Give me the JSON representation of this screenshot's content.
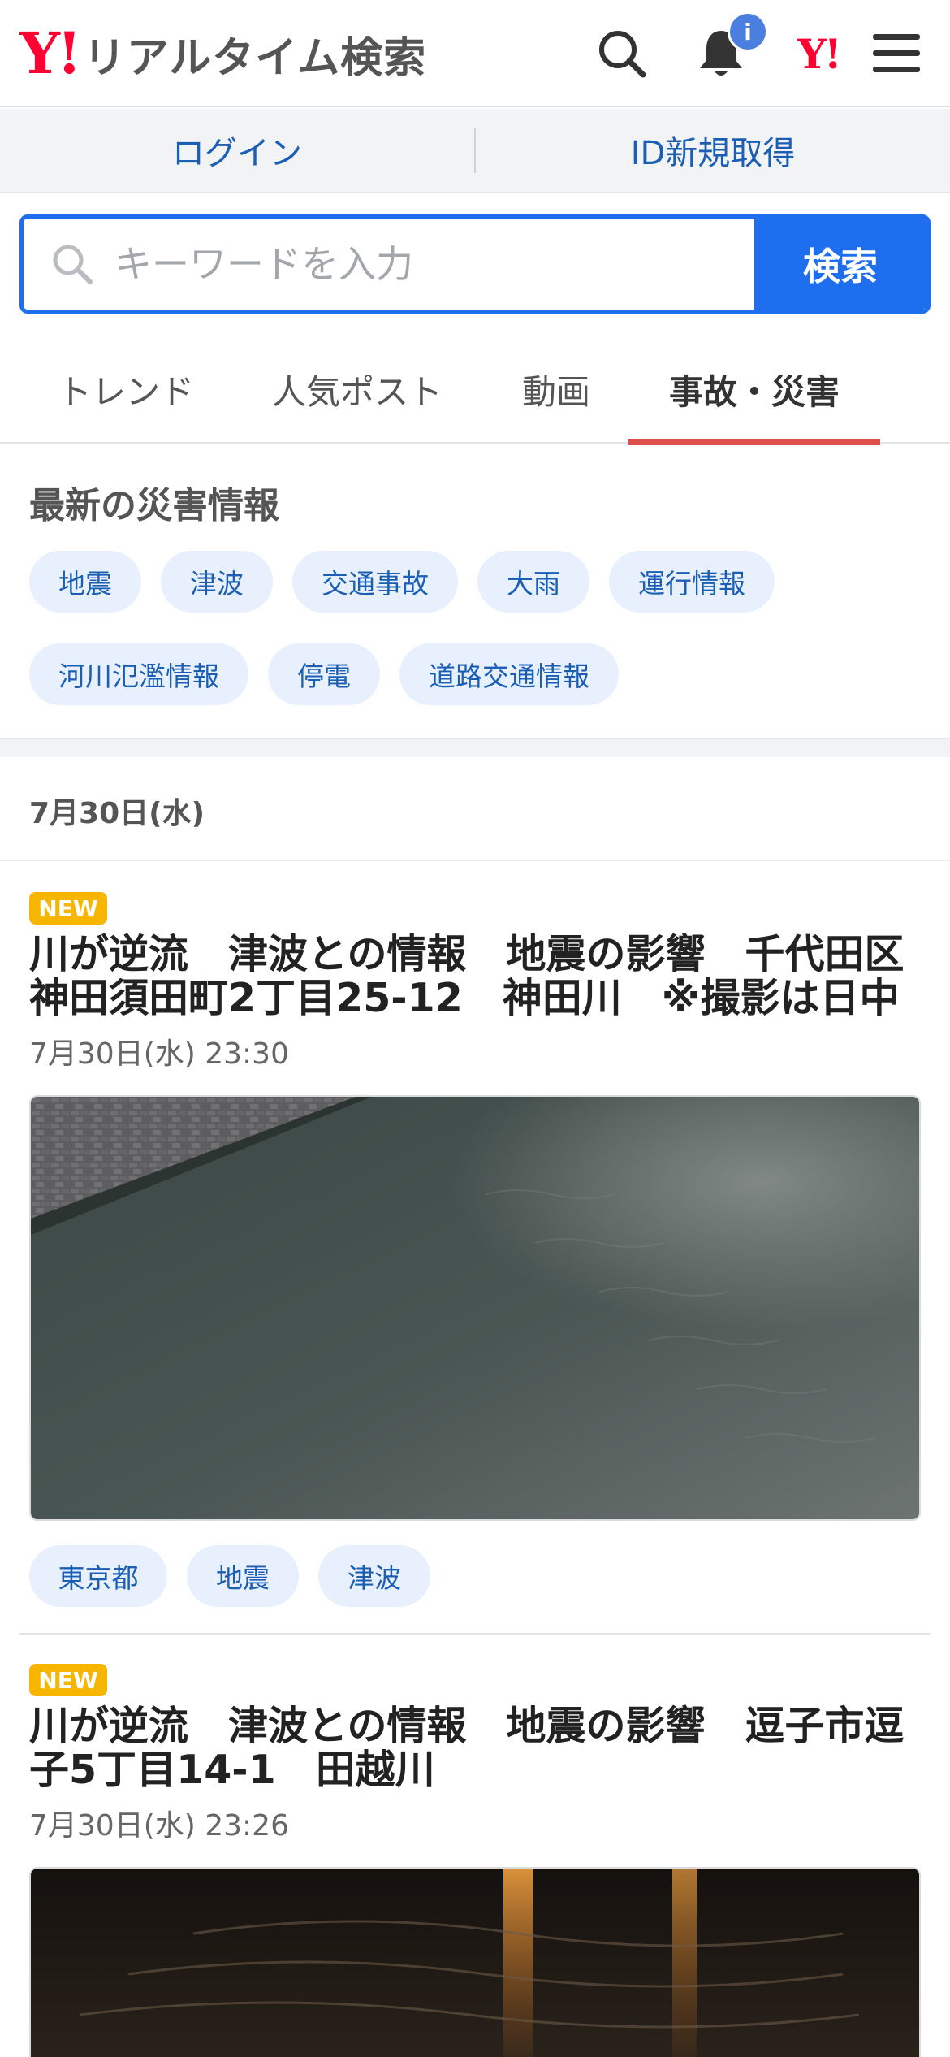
{
  "header": {
    "logo_mark": "Y!",
    "service_name": "リアルタイム検索",
    "notification_badge": "i",
    "yahoo_mark": "Y!"
  },
  "login_bar": {
    "login": "ログイン",
    "signup": "ID新規取得"
  },
  "search": {
    "placeholder": "キーワードを入力",
    "button": "検索"
  },
  "tabs": [
    {
      "label": "トレンド"
    },
    {
      "label": "人気ポスト"
    },
    {
      "label": "動画"
    },
    {
      "label": "事故・災害",
      "active": true
    }
  ],
  "disaster": {
    "title": "最新の災害情報",
    "chips": [
      "地震",
      "津波",
      "交通事故",
      "大雨",
      "運行情報",
      "河川氾濫情報",
      "停電",
      "道路交通情報"
    ]
  },
  "date_heading": "7月30日(水)",
  "posts": [
    {
      "badge": "NEW",
      "title_line1": "川が逆流　津波との情報　地震の影響　千代田区",
      "title_line2": "神田須田町2丁目25-12　神田川　※撮影は日中",
      "time": "7月30日(水) 23:30",
      "tags": [
        "東京都",
        "地震",
        "津波"
      ]
    },
    {
      "badge": "NEW",
      "title_line1": "川が逆流　津波との情報　地震の影響　逗子市逗",
      "title_line2": "子5丁目14-1　田越川",
      "time": "7月30日(水) 23:26"
    }
  ],
  "colors": {
    "accent_blue": "#1e6ef0",
    "link_blue": "#1a5fb4",
    "tab_indicator": "#e0504a",
    "new_badge": "#f7b500",
    "yahoo_red": "#ff0033"
  }
}
